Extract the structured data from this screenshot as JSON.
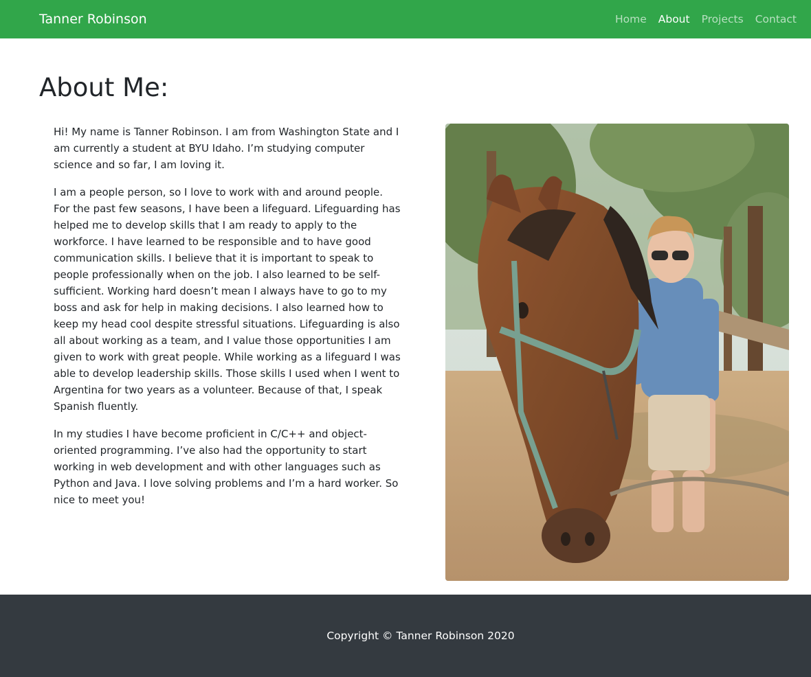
{
  "navbar": {
    "brand": "Tanner Robinson",
    "links": [
      {
        "label": "Home",
        "active": false
      },
      {
        "label": "About",
        "active": true
      },
      {
        "label": "Projects",
        "active": false
      },
      {
        "label": "Contact",
        "active": false
      }
    ],
    "color": "#31a64a"
  },
  "main": {
    "title": "About Me:",
    "paragraphs": [
      "Hi! My name is Tanner Robinson. I am from Washington State and I am currently a student at BYU Idaho. I’m studying computer science and so far, I am loving it.",
      "I am a people person, so I love to work with and around people. For the past few seasons, I have been a lifeguard. Lifeguarding has helped me to develop skills that I am ready to apply to the workforce. I have learned to be responsible and to have good communication skills. I believe that it is important to speak to people professionally when on the job. I also learned to be self-sufficient. Working hard doesn’t mean I always have to go to my boss and ask for help in making decisions. I also learned how to keep my head cool despite stressful situations. Lifeguarding is also all about working as a team, and I value those opportunities I am given to work with great people. While working as a lifeguard I was able to develop leadership skills. Those skills I used when I went to Argentina for two years as a volunteer. Because of that, I speak Spanish fluently.",
      "In my studies I have become proficient in C/C++ and object-oriented programming. I’ve also had the opportunity to start working in web development and with other languages such as Python and Java. I love solving problems and I’m a hard worker. So nice to meet you!"
    ]
  },
  "footer": {
    "copyright": "Copyright © Tanner Robinson 2020",
    "color": "#343a40"
  }
}
